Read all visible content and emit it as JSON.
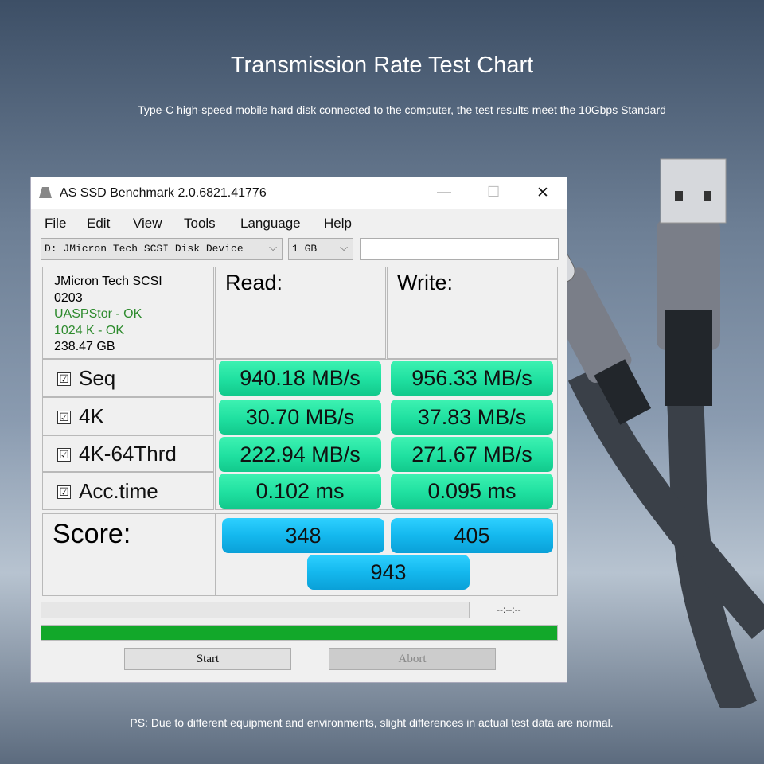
{
  "header": {
    "title": "Transmission Rate Test Chart",
    "subtitle": "Type-C high-speed mobile hard disk connected to the computer, the test results meet the 10Gbps Standard"
  },
  "footer": {
    "note": "PS: Due to different equipment and environments, slight differences in actual test data are normal."
  },
  "window": {
    "title": "AS SSD Benchmark 2.0.6821.41776",
    "minimize": "—",
    "maximize": "☐",
    "close": "✕"
  },
  "menu": [
    "File",
    "Edit",
    "View",
    "Tools",
    "Language",
    "Help"
  ],
  "toolbar": {
    "drive": "D: JMicron Tech SCSI Disk Device",
    "size": "1 GB",
    "chevron": "⌵",
    "text_field": ""
  },
  "info": {
    "name": "JMicron Tech SCSI",
    "firmware": "0203",
    "driver": "UASPStor - OK",
    "alignment": "1024 K - OK",
    "capacity": "238.47 GB"
  },
  "columns": {
    "read": "Read:",
    "write": "Write:"
  },
  "rows": [
    {
      "label": "Seq",
      "checked": true,
      "read": "940.18 MB/s",
      "write": "956.33 MB/s"
    },
    {
      "label": "4K",
      "checked": true,
      "read": "30.70 MB/s",
      "write": "37.83 MB/s"
    },
    {
      "label": "4K-64Thrd",
      "checked": true,
      "read": "222.94 MB/s",
      "write": "271.67 MB/s"
    },
    {
      "label": "Acc.time",
      "checked": true,
      "read": "0.102 ms",
      "write": "0.095 ms"
    }
  ],
  "check_mark": "☑",
  "score": {
    "label": "Score:",
    "read": "348",
    "write": "405",
    "total": "943"
  },
  "progress": {
    "time": "--:--:--",
    "test_progress": 0,
    "overall_progress": 100
  },
  "buttons": {
    "start": "Start",
    "abort": "Abort"
  },
  "colors": {
    "result_green": "#1fe0a0",
    "score_blue": "#14b8ee",
    "progress_green": "#12a82a"
  }
}
